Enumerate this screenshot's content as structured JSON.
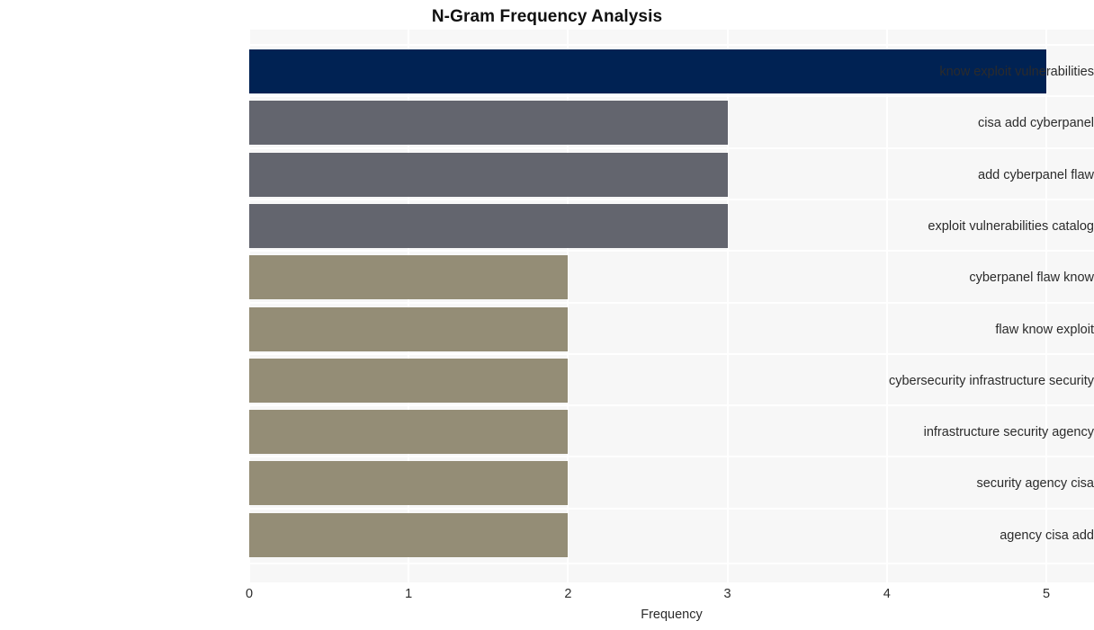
{
  "chart_data": {
    "type": "bar",
    "orientation": "horizontal",
    "title": "N-Gram Frequency Analysis",
    "xlabel": "Frequency",
    "ylabel": "",
    "categories": [
      "know exploit vulnerabilities",
      "cisa add cyberpanel",
      "add cyberpanel flaw",
      "exploit vulnerabilities catalog",
      "cyberpanel flaw know",
      "flaw know exploit",
      "cybersecurity infrastructure security",
      "infrastructure security agency",
      "security agency cisa",
      "agency cisa add"
    ],
    "values": [
      5,
      3,
      3,
      3,
      2,
      2,
      2,
      2,
      2,
      2
    ],
    "bar_colors": [
      "#002253",
      "#63656e",
      "#63656e",
      "#63656e",
      "#948d76",
      "#948d76",
      "#948d76",
      "#948d76",
      "#948d76",
      "#948d76"
    ],
    "xlim": [
      0,
      5
    ],
    "xticks": [
      0,
      1,
      2,
      3,
      4,
      5
    ],
    "xtick_labels": [
      "0",
      "1",
      "2",
      "3",
      "4",
      "5"
    ],
    "grid": true,
    "grid_color": "#ffffff",
    "plot_background": "#f7f7f7",
    "figure_background": "#ffffff",
    "legend": null
  }
}
